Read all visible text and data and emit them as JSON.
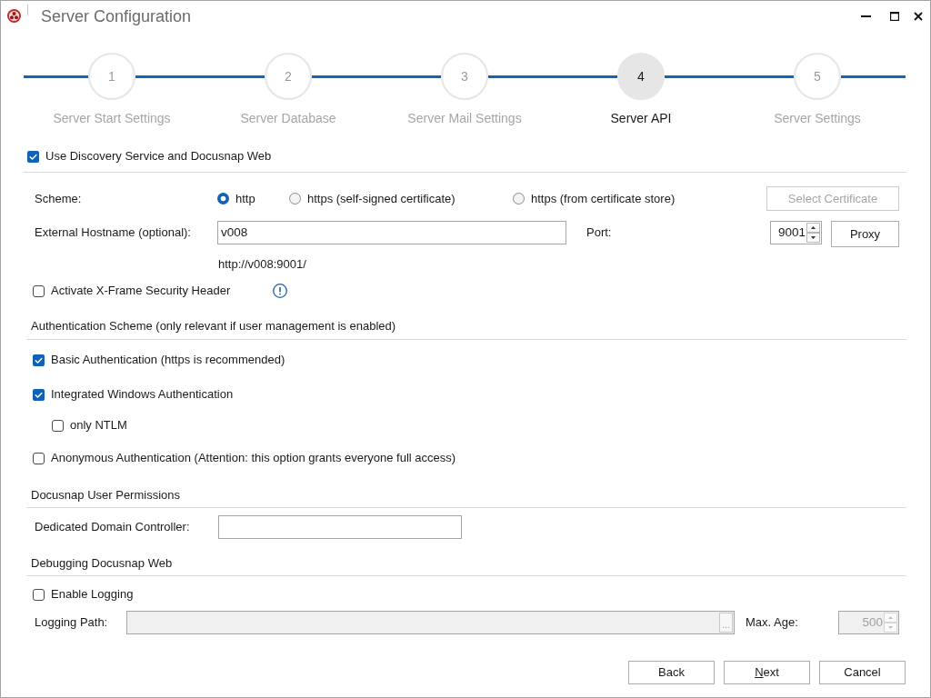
{
  "window": {
    "title": "Server Configuration"
  },
  "steps": [
    {
      "number": "1",
      "label": "Server Start Settings",
      "selected": false
    },
    {
      "number": "2",
      "label": "Server Database",
      "selected": false
    },
    {
      "number": "3",
      "label": "Server Mail Settings",
      "selected": false
    },
    {
      "number": "4",
      "label": "Server API",
      "selected": true
    },
    {
      "number": "5",
      "label": "Server Settings",
      "selected": false
    }
  ],
  "discovery_service": {
    "label": "Use Discovery Service and Docusnap Web",
    "checked": true
  },
  "scheme": {
    "label": "Scheme:",
    "options": [
      {
        "label": "http",
        "selected": true
      },
      {
        "label": "https (self-signed certificate)",
        "selected": false
      },
      {
        "label": "https (from certificate store)",
        "selected": false
      }
    ]
  },
  "select_certificate_button": {
    "label": "Select Certificate",
    "disabled": true
  },
  "external_hostname": {
    "label": "External Hostname (optional):",
    "value": "v008"
  },
  "port": {
    "label": "Port:",
    "value": "9001"
  },
  "proxy_button": {
    "label": "Proxy",
    "disabled": false
  },
  "resulting_url": "http://v008:9001/",
  "x_frame_header": {
    "label": "Activate X-Frame Security Header",
    "checked": false
  },
  "authentication": {
    "heading": "Authentication Scheme (only relevant if user management is enabled)",
    "options": [
      {
        "label": "Basic Authentication (https is recommended)",
        "checked": true
      },
      {
        "label": "Integrated Windows Authentication",
        "checked": true,
        "children": [
          {
            "label": "only NTLM",
            "checked": false
          }
        ]
      },
      {
        "label": "Anonymous Authentication (Attention: this option grants everyone full access)",
        "checked": false
      }
    ]
  },
  "user_permissions": {
    "heading": "Docusnap User Permissions",
    "domain_controller": {
      "label": "Dedicated Domain Controller:"
    }
  },
  "debugging": {
    "heading": "Debugging Docusnap Web",
    "enable_logging": {
      "label": "Enable Logging",
      "checked": false
    },
    "logging_path": {
      "label": "Logging Path:",
      "disabled": true,
      "browse_label": "..."
    },
    "max_age": {
      "label": "Max. Age:",
      "value": "500",
      "disabled": true
    }
  },
  "footer": {
    "back_button": {
      "label": "Back",
      "mnemonic": false
    },
    "next_button": {
      "label": "Next",
      "mnemonic": true
    },
    "cancel_button": {
      "label": "Cancel",
      "mnemonic": false
    }
  }
}
